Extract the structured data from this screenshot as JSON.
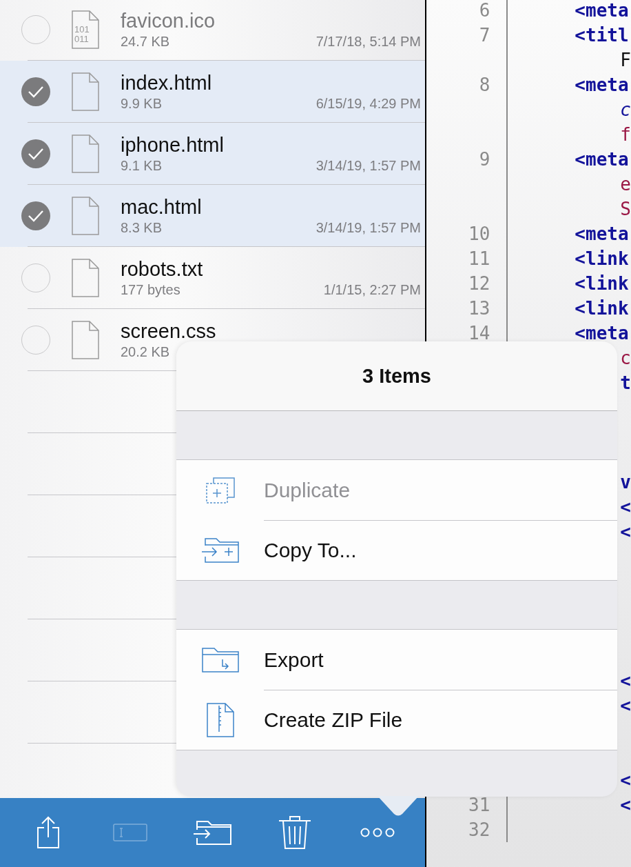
{
  "files": [
    {
      "name": "favicon.ico",
      "size": "24.7 KB",
      "modified": "7/17/18, 5:14 PM",
      "kind": "binary",
      "icon_label": [
        "101",
        "011"
      ],
      "selected": false,
      "dimmed": true
    },
    {
      "name": "index.html",
      "size": "9.9 KB",
      "modified": "6/15/19, 4:29 PM",
      "kind": "document",
      "selected": true,
      "dimmed": false
    },
    {
      "name": "iphone.html",
      "size": "9.1 KB",
      "modified": "3/14/19, 1:57 PM",
      "kind": "document",
      "selected": true,
      "dimmed": false
    },
    {
      "name": "mac.html",
      "size": "8.3 KB",
      "modified": "3/14/19, 1:57 PM",
      "kind": "document",
      "selected": true,
      "dimmed": false
    },
    {
      "name": "robots.txt",
      "size": "177 bytes",
      "modified": "1/1/15, 2:27 PM",
      "kind": "document",
      "selected": false,
      "dimmed": false
    },
    {
      "name": "screen.css",
      "size": "20.2 KB",
      "kind": "document",
      "selected": false,
      "dimmed": false
    }
  ],
  "code_lines": [
    {
      "number": "6",
      "kind": "tag",
      "code": "<meta"
    },
    {
      "number": "7",
      "kind": "tag",
      "code": "<titl"
    },
    {
      "kind": "text",
      "code": "F"
    },
    {
      "number": "8",
      "kind": "tag",
      "code": "<meta"
    },
    {
      "kind": "attr",
      "code": "c"
    },
    {
      "kind": "value",
      "code": "f"
    },
    {
      "number": "9",
      "kind": "tag",
      "code": "<meta"
    },
    {
      "kind": "value",
      "code": "e"
    },
    {
      "kind": "value",
      "code": "S"
    },
    {
      "number": "10",
      "kind": "tag",
      "code": "<meta"
    },
    {
      "number": "11",
      "kind": "tag",
      "code": "<link"
    },
    {
      "number": "12",
      "kind": "tag",
      "code": "<link"
    },
    {
      "number": "13",
      "kind": "tag",
      "code": "<link"
    },
    {
      "number": "14",
      "kind": "tag",
      "code": "<meta"
    },
    {
      "kind": "value",
      "code": "c"
    },
    {
      "kind": "cont",
      "code": "t"
    },
    {
      "kind": "cont",
      "code": "v"
    },
    {
      "kind": "cont",
      "code": "<"
    },
    {
      "kind": "cont",
      "code": "<"
    },
    {
      "kind": "cont",
      "code": "<"
    },
    {
      "kind": "cont",
      "code": "<"
    },
    {
      "kind": "cont",
      "code": "<"
    },
    {
      "number": "31",
      "kind": "cont",
      "code": "<"
    },
    {
      "number": "32"
    }
  ],
  "popover": {
    "title": "3 Items",
    "groups": [
      [
        {
          "label": "Duplicate",
          "kind": "duplicate",
          "disabled": true
        },
        {
          "label": "Copy To...",
          "kind": "copy",
          "disabled": false
        }
      ],
      [
        {
          "label": "Export",
          "kind": "export",
          "disabled": false
        },
        {
          "label": "Create ZIP File",
          "kind": "zip",
          "disabled": false
        }
      ]
    ]
  },
  "toolbar": [
    {
      "kind": "share",
      "disabled": false
    },
    {
      "kind": "rename",
      "disabled": true
    },
    {
      "kind": "move",
      "disabled": false
    },
    {
      "kind": "trash",
      "disabled": false
    },
    {
      "kind": "more",
      "disabled": false
    }
  ]
}
